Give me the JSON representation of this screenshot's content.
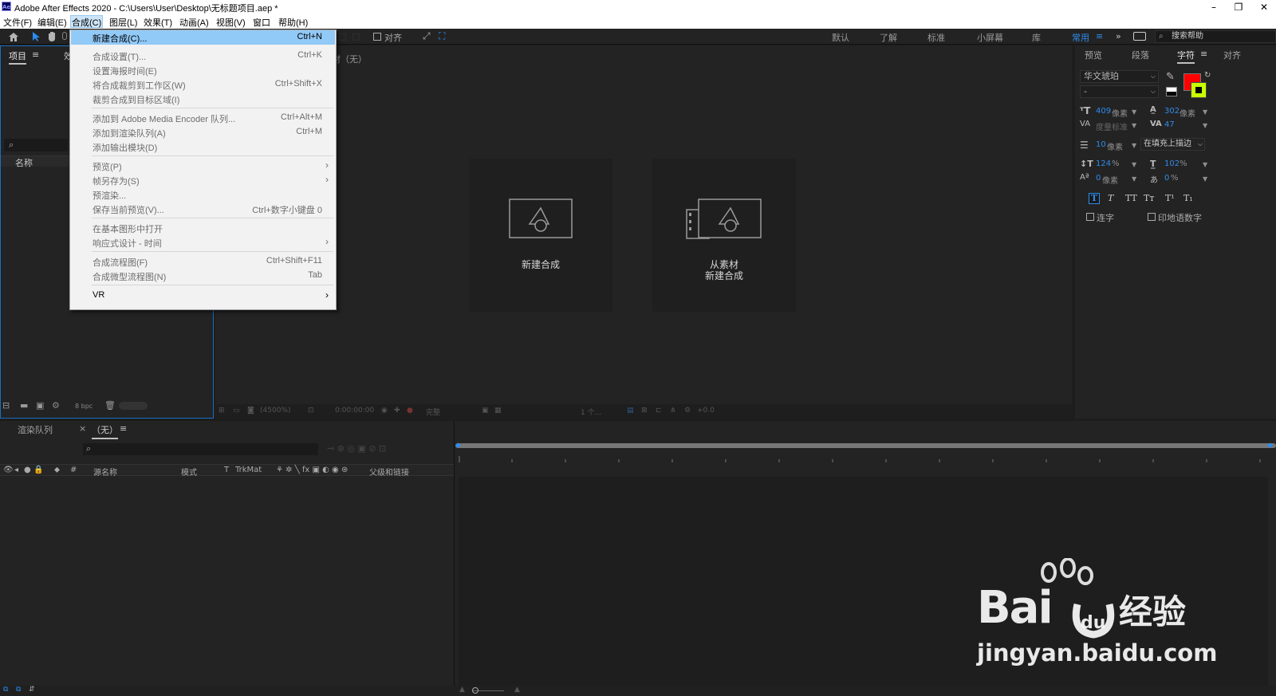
{
  "window": {
    "title": "Adobe After Effects 2020 - C:\\Users\\User\\Desktop\\无标题项目.aep *",
    "app_icon_text": "Ae"
  },
  "menubar": {
    "items": [
      "文件(F)",
      "编辑(E)",
      "合成(C)",
      "图层(L)",
      "效果(T)",
      "动画(A)",
      "视图(V)",
      "窗口",
      "帮助(H)"
    ]
  },
  "toolbar": {
    "align_label": "对齐",
    "workspaces": [
      "默认",
      "了解",
      "标准",
      "小屏幕",
      "库",
      "常用"
    ],
    "active_workspace": "常用",
    "search_placeholder": "搜索帮助"
  },
  "project_panel": {
    "tabs": [
      "项目",
      "效"
    ],
    "column_name": "名称",
    "bpc": "8 bpc"
  },
  "viewer": {
    "header": "材（无）",
    "card_new": "新建合成",
    "card_from_footage_line1": "从素材",
    "card_from_footage_line2": "新建合成",
    "zoom": "(4500%)",
    "timecode": "0:00:00:00",
    "resolution": "完整",
    "views": "1 个...",
    "exposure": "+0.0"
  },
  "right_panel": {
    "tabs": [
      "预览",
      "段落",
      "字符",
      "对齐"
    ],
    "active_tab": "字符",
    "font_family": "华文琥珀",
    "font_style": "-",
    "font_size": "409",
    "font_size_unit": "像素",
    "leading": "302",
    "leading_unit": "像素",
    "kerning": "度量标准",
    "tracking": "47",
    "stroke_width": "10",
    "stroke_unit": "像素",
    "stroke_mode": "在填充上描边",
    "vertical_scale": "124",
    "horizontal_scale": "102",
    "percent": "%",
    "baseline_shift": "0",
    "baseline_unit": "像素",
    "tsume": "0",
    "style_buttons": [
      "T",
      "T",
      "TT",
      "Tт",
      "T¹",
      "T₁"
    ],
    "ligatures_label": "连字",
    "hindi_digits_label": "印地语数字",
    "fill_color": "#ff0000",
    "stroke_color": "#c8ff00"
  },
  "timeline": {
    "render_queue_tab": "渲染队列",
    "comp_tab": "（无）",
    "columns": [
      "#",
      "源名称",
      "模式",
      "T",
      "TrkMat",
      "父级和链接"
    ]
  },
  "composition_menu": {
    "items": [
      {
        "label": "新建合成(C)...",
        "shortcut": "Ctrl+N",
        "state": "highlight"
      },
      {
        "label": "合成设置(T)...",
        "shortcut": "Ctrl+K",
        "state": "disabled"
      },
      {
        "label": "设置海报时间(E)",
        "shortcut": "",
        "state": "disabled"
      },
      {
        "label": "将合成裁剪到工作区(W)",
        "shortcut": "Ctrl+Shift+X",
        "state": "disabled"
      },
      {
        "label": "裁剪合成到目标区域(I)",
        "shortcut": "",
        "state": "disabled"
      },
      {
        "label": "添加到 Adobe Media Encoder 队列...",
        "shortcut": "Ctrl+Alt+M",
        "state": "disabled"
      },
      {
        "label": "添加到渲染队列(A)",
        "shortcut": "Ctrl+M",
        "state": "disabled"
      },
      {
        "label": "添加输出模块(D)",
        "shortcut": "",
        "state": "disabled"
      },
      {
        "label": "预览(P)",
        "shortcut": "",
        "state": "disabled"
      },
      {
        "label": "帧另存为(S)",
        "shortcut": "",
        "state": "disabled"
      },
      {
        "label": "预渲染...",
        "shortcut": "",
        "state": "disabled"
      },
      {
        "label": "保存当前预览(V)...",
        "shortcut": "Ctrl+数字小键盘 0",
        "state": "disabled"
      },
      {
        "label": "在基本图形中打开",
        "shortcut": "",
        "state": "disabled"
      },
      {
        "label": "响应式设计 - 时间",
        "shortcut": "",
        "state": "disabled"
      },
      {
        "label": "合成流程图(F)",
        "shortcut": "Ctrl+Shift+F11",
        "state": "disabled"
      },
      {
        "label": "合成微型流程图(N)",
        "shortcut": "Tab",
        "state": "disabled"
      },
      {
        "label": "VR",
        "shortcut": "",
        "state": "enabled"
      }
    ]
  },
  "watermark": {
    "brand_left": "Bai",
    "brand_right": "经验",
    "url": "jingyan.baidu.com"
  }
}
